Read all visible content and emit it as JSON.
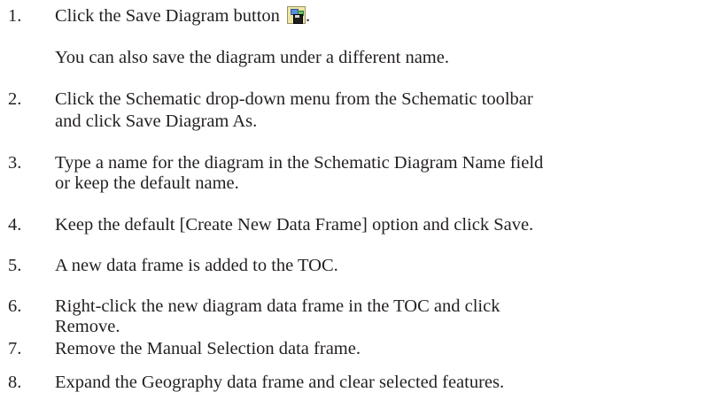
{
  "steps": [
    {
      "num": "1.",
      "lines": [
        "Click the Save Diagram button"
      ],
      "suffix": ".",
      "icon": "save-diagram-icon"
    },
    {
      "num": "",
      "lines": [
        "You can also save the diagram under a different name."
      ]
    },
    {
      "num": "2.",
      "lines": [
        "Click the Schematic drop-down menu from the Schematic toolbar",
        "and click Save Diagram As."
      ]
    },
    {
      "num": "3.",
      "lines": [
        "Type a name for the diagram in the Schematic Diagram Name field",
        "or keep the default name."
      ]
    },
    {
      "num": "4.",
      "lines": [
        "Keep the default [Create New Data Frame] option and click Save."
      ]
    },
    {
      "num": "5.",
      "lines": [
        "A new data frame is added to the TOC."
      ]
    },
    {
      "num": "6.",
      "lines": [
        "Right-click the new diagram data frame in the TOC and click",
        "Remove."
      ]
    },
    {
      "num": "7.",
      "lines": [
        "Remove the Manual Selection data frame."
      ]
    },
    {
      "num": "8.",
      "lines": [
        "Expand the Geography data frame and clear selected features."
      ]
    }
  ]
}
